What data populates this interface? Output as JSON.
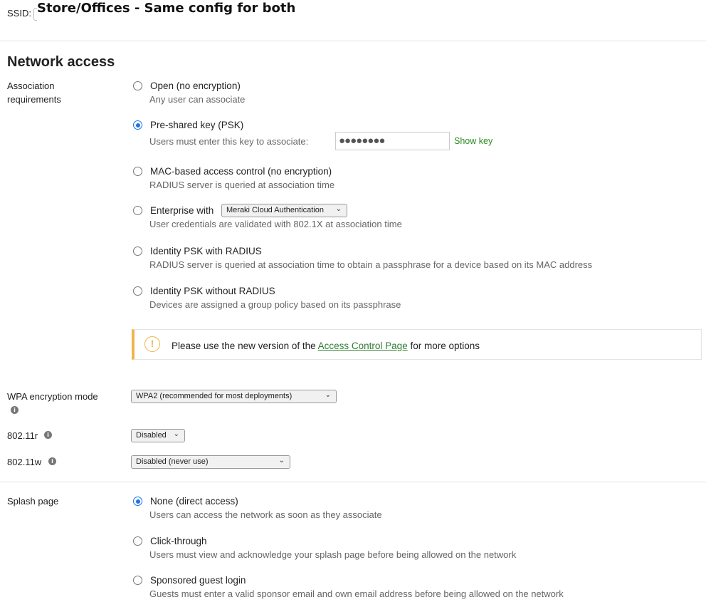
{
  "ssid": {
    "label": "SSID:",
    "overlay_title": "Store/Offices - Same config for both"
  },
  "network_access": {
    "title": "Network access",
    "association_label_line1": "Association",
    "association_label_line2": "requirements",
    "options": [
      {
        "title": "Open (no encryption)",
        "desc": "Any user can associate",
        "checked": false
      },
      {
        "title": "Pre-shared key (PSK)",
        "desc": "Users must enter this key to associate:",
        "checked": true
      },
      {
        "title": "MAC-based access control (no encryption)",
        "desc": "RADIUS server is queried at association time",
        "checked": false
      },
      {
        "title": "Enterprise with",
        "desc": "User credentials are validated with 802.1X at association time",
        "checked": false
      },
      {
        "title": "Identity PSK with RADIUS",
        "desc": "RADIUS server is queried at association time to obtain a passphrase for a device based on its MAC address",
        "checked": false
      },
      {
        "title": "Identity PSK without RADIUS",
        "desc": "Devices are assigned a group policy based on its passphrase",
        "checked": false
      }
    ],
    "psk_value": "●●●●●●●●",
    "show_key": "Show key",
    "enterprise_select": "Meraki Cloud Authentication",
    "notice": {
      "before": "Please use the new version of the ",
      "link": "Access Control Page",
      "after": " for more options"
    }
  },
  "wpa": {
    "label": "WPA encryption mode",
    "value": "WPA2 (recommended for most deployments)"
  },
  "r80211": {
    "label": "802.11r",
    "value": "Disabled"
  },
  "w80211": {
    "label": "802.11w",
    "value": "Disabled (never use)"
  },
  "splash": {
    "label": "Splash page",
    "options": [
      {
        "title": "None (direct access)",
        "desc": "Users can access the network as soon as they associate",
        "checked": true
      },
      {
        "title": "Click-through",
        "desc": "Users must view and acknowledge your splash page before being allowed on the network",
        "checked": false
      },
      {
        "title": "Sponsored guest login",
        "desc": "Guests must enter a valid sponsor email and own email address before being allowed on the network",
        "checked": false
      }
    ]
  },
  "icons": {
    "info": "info-icon",
    "warning": "warning-icon",
    "chevron": "chevron-down-icon"
  },
  "colors": {
    "accent": "#1a73e8",
    "link": "#2e7d32",
    "warning": "#f0b44c"
  }
}
